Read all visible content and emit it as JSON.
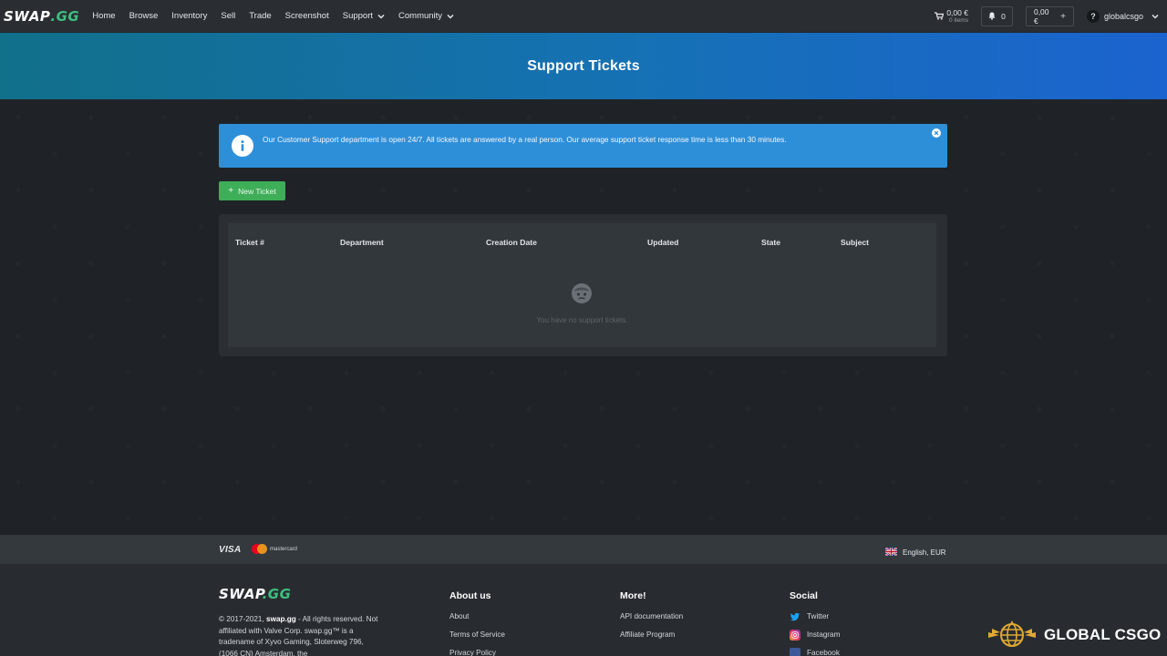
{
  "nav": {
    "logo_a": "SWAP",
    "logo_b": ".GG",
    "links": [
      "Home",
      "Browse",
      "Inventory",
      "Sell",
      "Trade",
      "Screenshot",
      "Support",
      "Community"
    ],
    "cart_amount": "0,00 €",
    "cart_items": "0 items",
    "notifications": "0",
    "balance": "0,00 €",
    "balance_plus": "+",
    "avatar": "?",
    "username": "globalcsgo"
  },
  "hero": {
    "title": "Support Tickets"
  },
  "alert": {
    "message": "Our Customer Support department is open 24/7. All tickets are answered by a real person. Our average support ticket response time is less than 30 minutes."
  },
  "new_ticket": {
    "icon": "+",
    "label": "New Ticket"
  },
  "table": {
    "headers": [
      "Ticket #",
      "Department",
      "Creation Date",
      "Updated",
      "State",
      "Subject"
    ],
    "empty_text": "You have no support tickets."
  },
  "payments": {
    "visa": "VISA",
    "mastercard": "mastercard",
    "language": "English, EUR"
  },
  "footer": {
    "logo_a": "SWAP",
    "logo_b": ".GG",
    "copyright_1": "© 2017-2021, ",
    "copyright_site": "swap.gg",
    "copyright_2": " - All rights reserved. Not affiliated with Valve Corp. swap.gg™ is a tradename of Xyvo Gaming, Sloterweg 796, (1066 CN) Amsterdam, the",
    "about": {
      "title": "About us",
      "links": [
        "About",
        "Terms of Service",
        "Privacy Policy"
      ]
    },
    "more": {
      "title": "More!",
      "links": [
        "API documentation",
        "Affiliate Program"
      ]
    },
    "social": {
      "title": "Social",
      "links": [
        "Twitter",
        "Instagram",
        "Facebook"
      ]
    }
  },
  "watermark": {
    "text": "GLOBAL CSGO"
  },
  "colors": {
    "accent_green": "#3fae58",
    "alert_blue": "#2e8fd9",
    "logo_green": "#3fbf7f"
  }
}
